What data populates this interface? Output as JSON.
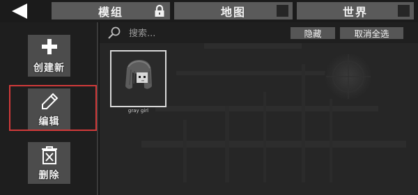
{
  "header": {
    "tabs": [
      {
        "label": "模组",
        "indicator": "lock-icon"
      },
      {
        "label": "地图",
        "indicator": "checkbox"
      },
      {
        "label": "世界",
        "indicator": "checkbox"
      }
    ]
  },
  "sidebar": {
    "buttons": [
      {
        "label": "创建新",
        "icon": "plus-icon"
      },
      {
        "label": "编辑",
        "icon": "pencil-icon"
      },
      {
        "label": "删除",
        "icon": "trash-icon"
      }
    ],
    "highlighted": "编辑"
  },
  "toolbar": {
    "search_placeholder": "搜索...",
    "hide_label": "隐藏",
    "deselect_all_label": "取消全选"
  },
  "items": [
    {
      "name": "gray girl"
    }
  ],
  "colors": {
    "highlight": "#d23a3a",
    "tab_bg": "#5a5a5a",
    "button_bg": "#4c4c4c"
  }
}
